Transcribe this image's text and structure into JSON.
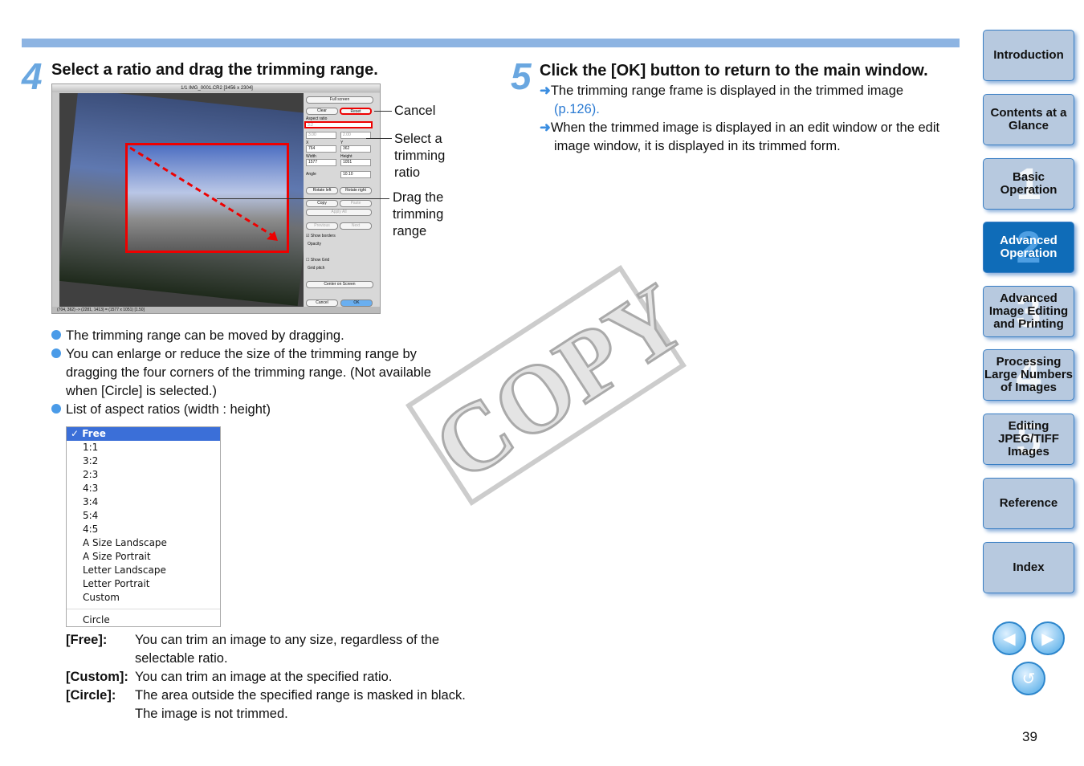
{
  "step4": {
    "number": "4",
    "title": "Select a ratio and drag the trimming range."
  },
  "step5": {
    "number": "5",
    "title": "Click the [OK] button to return to the main window.",
    "items": [
      {
        "text": "The trimming range frame is displayed in the trimmed image",
        "link": "(p.126)."
      },
      {
        "text": "When the trimmed image is displayed in an edit window or the edit image window, it is displayed in its trimmed form."
      }
    ]
  },
  "screenshot": {
    "window_title": "1/1 IMG_0001.CR2 [3456 x 2304]",
    "full_screen": "Full screen",
    "clear": "Clear",
    "reset": "Reset",
    "aspect_ratio_label": "Aspect ratio",
    "aspect_ratio": "3:2",
    "ratio_w": "3.00",
    "ratio_h": "2.00",
    "x_label": "X",
    "x": "764",
    "y_label": "Y",
    "y": "362",
    "width_label": "Width",
    "width": "1577",
    "height_label": "Height",
    "height": "1051",
    "angle_label": "Angle",
    "angle": "10.10",
    "rotate_left": "Rotate left",
    "rotate_right": "Rotate right",
    "copy": "Copy",
    "paste": "Paste",
    "apply_all": "Apply All",
    "previous": "Previous",
    "next": "Next",
    "show_borders": "Show borders",
    "opacity": "Opacity",
    "show_grid": "Show Grid",
    "grid_pitch": "Grid pitch",
    "center": "Center on Screen",
    "cancel": "Cancel",
    "ok": "OK",
    "status": "(704, 362) -> (2281, 1413) = (1577 x 1051) [1.50]"
  },
  "callouts": {
    "cancel": "Cancel",
    "select_ratio": "Select a trimming ratio",
    "drag": "Drag the trimming range"
  },
  "bullets": [
    "The trimming range can be moved by dragging.",
    "You can enlarge or reduce the size of the trimming range by dragging the four corners of the trimming range. (Not available when [Circle] is selected.)",
    "List of aspect ratios (width : height)"
  ],
  "ratio_menu": {
    "selected": "✓ Free",
    "items": [
      "1:1",
      "3:2",
      "2:3",
      "4:3",
      "3:4",
      "5:4",
      "4:5",
      "A Size Landscape",
      "A Size Portrait",
      "Letter Landscape",
      "Letter Portrait",
      "Custom"
    ],
    "last": "Circle"
  },
  "definitions": [
    {
      "term": "[Free]:",
      "desc": "You can trim an image to any size, regardless of the selectable ratio."
    },
    {
      "term": "[Custom]:",
      "desc": "You can trim an image at the specified ratio."
    },
    {
      "term": "[Circle]:",
      "desc": "The area outside the specified range is masked in black. The image is not trimmed."
    }
  ],
  "watermark": "COPY",
  "sidebar": [
    {
      "label": "Introduction",
      "digit": ""
    },
    {
      "label": "Contents at a Glance",
      "digit": ""
    },
    {
      "label": "Basic Operation",
      "digit": "1"
    },
    {
      "label": "Advanced Operation",
      "digit": "2",
      "active": true
    },
    {
      "label": "Advanced Image Editing and Printing",
      "digit": "3"
    },
    {
      "label": "Processing Large Numbers of Images",
      "digit": "4"
    },
    {
      "label": "Editing JPEG/TIFF Images",
      "digit": "5"
    },
    {
      "label": "Reference",
      "digit": ""
    },
    {
      "label": "Index",
      "digit": ""
    }
  ],
  "nav": {
    "prev": "prev-page",
    "next": "next-page",
    "back": "return"
  },
  "page_number": "39",
  "colors": {
    "accent": "#8db4e2",
    "active_tab": "#0f6cb8",
    "tab": "#b7c9df",
    "highlight": "#e00000"
  }
}
